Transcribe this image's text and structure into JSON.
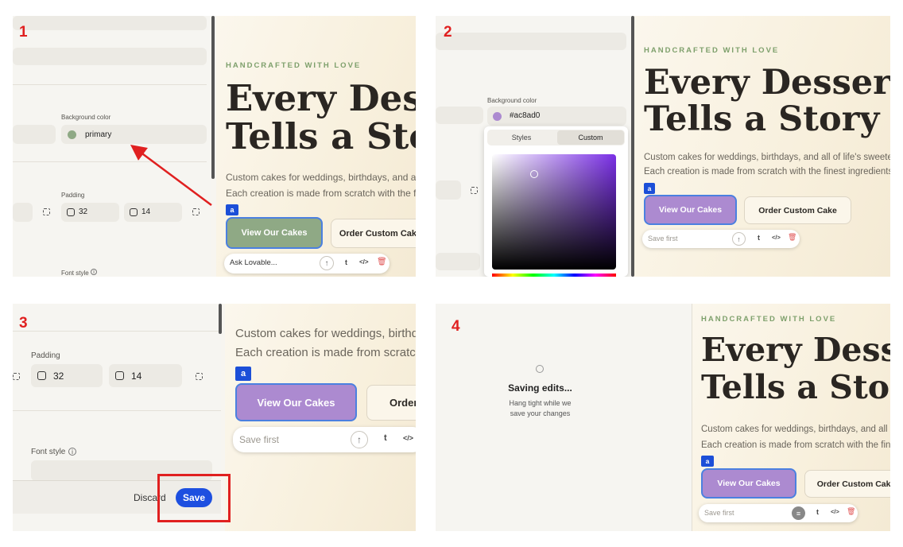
{
  "steps": [
    "1",
    "2",
    "3",
    "4"
  ],
  "colors": {
    "annotation_red": "#e02020",
    "primary_green": "#8fa985",
    "lavender": "#ac8ad0",
    "save_blue": "#1d4fe0",
    "tag_blue": "#1c4fd8"
  },
  "editor": {
    "background_color_label": "Background color",
    "background_value_step1": "primary",
    "background_value_step2": "#ac8ad0",
    "padding_label": "Padding",
    "padding_values": [
      "32",
      "14"
    ],
    "font_style_label": "Font style",
    "tabs": [
      "Styles",
      "Custom"
    ],
    "discard_label": "Discard",
    "save_label": "Save"
  },
  "preview": {
    "eyebrow": "HANDCRAFTED WITH LOVE",
    "headline_line1": "Every Dessert",
    "headline_line2": "Tells a Story",
    "body_line1": "Custom cakes for weddings, birthdays, and all of life's sweetest moments.",
    "body_line2": "Each creation is made from scratch with the finest ingredients.",
    "primary_button": "View Our Cakes",
    "secondary_button": "Order Custom Cake",
    "secondary_button_short": "Order",
    "element_tag": "a"
  },
  "prompt": {
    "placeholder_step1": "Ask Lovable...",
    "placeholder_saving": "Save first"
  },
  "saving": {
    "title": "Saving edits...",
    "subtitle_line1": "Hang tight while we",
    "subtitle_line2": "save your changes"
  }
}
